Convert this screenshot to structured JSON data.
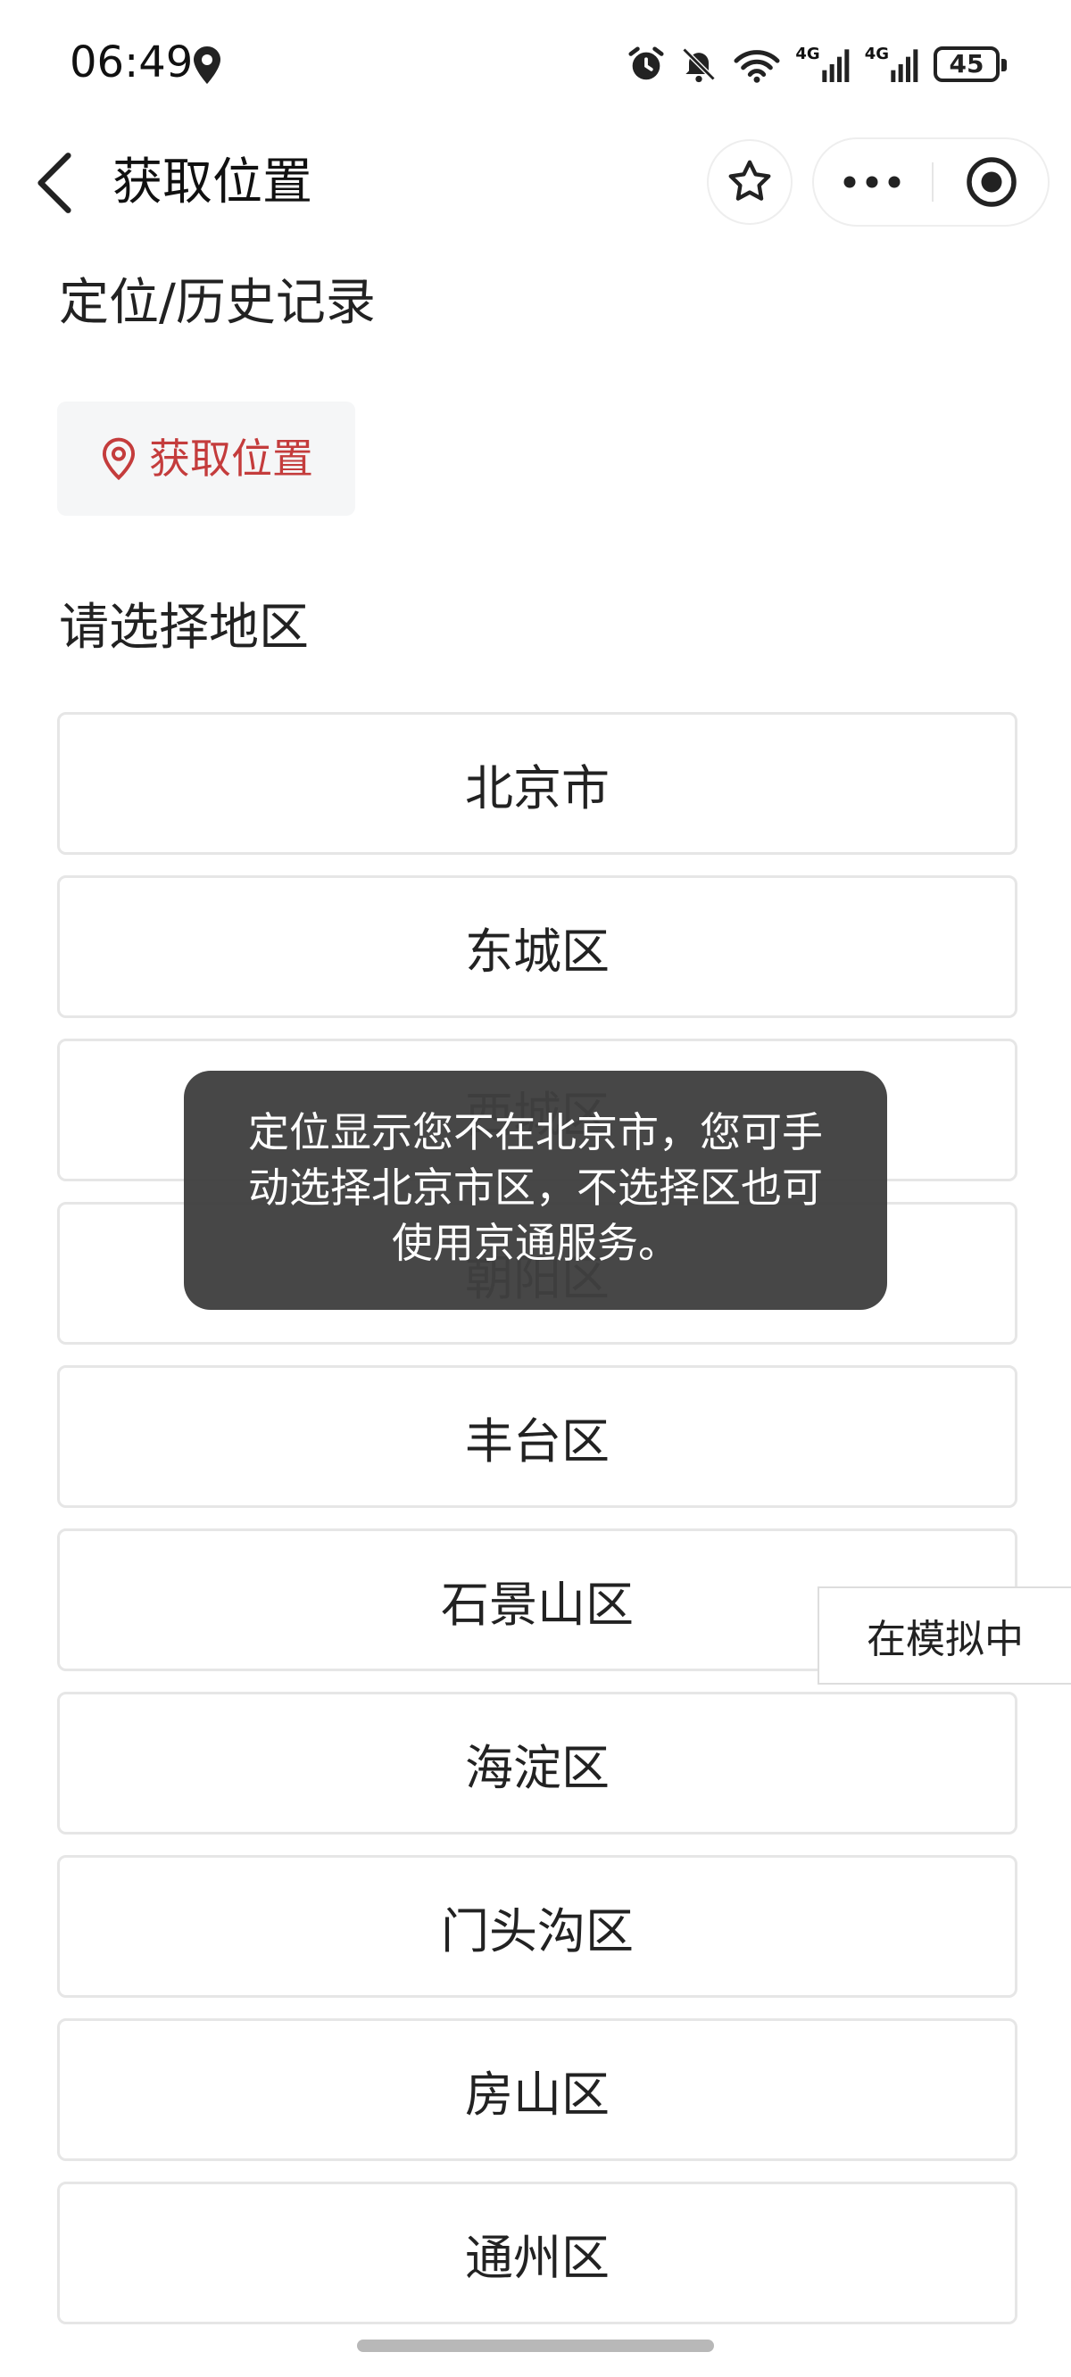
{
  "status_bar": {
    "time": "06:49",
    "network_left": "4G",
    "network_right": "4G",
    "battery": "45"
  },
  "nav": {
    "title": "获取位置",
    "icons": [
      "back-arrow-icon",
      "star-icon",
      "more-dots-icon",
      "close-target-icon"
    ]
  },
  "location_section": {
    "title": "定位/历史记录",
    "button_label": "获取位置",
    "button_icon": "location-pin-icon",
    "accent_color": "#c43c3c"
  },
  "district_section": {
    "title": "请选择地区",
    "items": [
      "北京市",
      "东城区",
      "西城区",
      "朝阳区",
      "丰台区",
      "石景山区",
      "海淀区",
      "门头沟区",
      "房山区",
      "通州区"
    ]
  },
  "toast": {
    "message": "定位显示您不在北京市，您可手动选择北京市区，不选择区也可使用京通服务。"
  },
  "sim_tag": {
    "label": "在模拟中"
  }
}
